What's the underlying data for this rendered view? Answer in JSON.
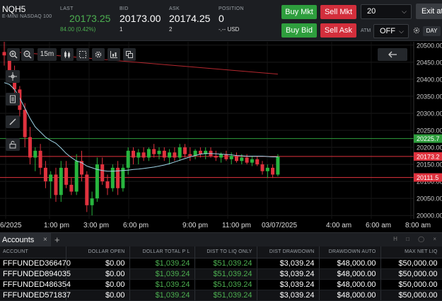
{
  "symbol": {
    "code": "NQH5",
    "description": "E-MINI NASDAQ 100"
  },
  "quote": {
    "last_label": "LAST",
    "last_value": "20173.25",
    "last_change": "84.00 (0.42%)",
    "bid_label": "BID",
    "bid_value": "20173.00",
    "bid_size": "1",
    "ask_label": "ASK",
    "ask_value": "20174.25",
    "ask_size": "2",
    "position_label": "POSITION",
    "position_value": "0",
    "position_sub": "-.-- USD"
  },
  "trade_buttons": {
    "buy_mkt": "Buy Mkt",
    "sell_mkt": "Sell Mkt",
    "buy_bid": "Buy Bid",
    "sell_ask": "Sell Ask",
    "exit": "Exit at"
  },
  "quantity": {
    "value": "20"
  },
  "atm": {
    "label": "ATM",
    "value": "OFF"
  },
  "day_button": "DAY",
  "colors": {
    "up": "#27b53e",
    "down": "#e0323e",
    "ma": "#9fd3e6",
    "green_level": "#2e9e3d",
    "red_level": "#e0323e"
  },
  "chart_data": {
    "type": "candlestick",
    "timeframe": "15m",
    "ylim": [
      19990,
      20510
    ],
    "y_ticks": [
      20000,
      20050,
      20100,
      20150,
      20200,
      20250,
      20300,
      20350,
      20400,
      20450,
      20500
    ],
    "y_tick_labels": [
      "20000.00",
      "20050.00",
      "20100.00",
      "20150.00",
      "20200.00",
      "20250.00",
      "20300.00",
      "20350.00",
      "20400.00",
      "20450.00",
      "20500.00"
    ],
    "x_tick_labels": [
      "6/2025",
      "1:00 pm",
      "3:00 pm",
      "6:00 pm",
      "9:00 pm",
      "11:00 pm",
      "03/07/2025",
      "4:00 am",
      "6:00 am",
      "8:00 am"
    ],
    "candles": [
      {
        "o": 20480,
        "h": 20510,
        "l": 20440,
        "c": 20470
      },
      {
        "o": 20470,
        "h": 20490,
        "l": 20400,
        "c": 20420
      },
      {
        "o": 20420,
        "h": 20440,
        "l": 20350,
        "c": 20370
      },
      {
        "o": 20370,
        "h": 20380,
        "l": 20290,
        "c": 20310
      },
      {
        "o": 20310,
        "h": 20330,
        "l": 20200,
        "c": 20230
      },
      {
        "o": 20230,
        "h": 20260,
        "l": 20150,
        "c": 20170
      },
      {
        "o": 20170,
        "h": 20200,
        "l": 20130,
        "c": 20190
      },
      {
        "o": 20190,
        "h": 20210,
        "l": 20120,
        "c": 20140
      },
      {
        "o": 20140,
        "h": 20160,
        "l": 20080,
        "c": 20100
      },
      {
        "o": 20100,
        "h": 20130,
        "l": 20050,
        "c": 20120
      },
      {
        "o": 20120,
        "h": 20140,
        "l": 20040,
        "c": 20060
      },
      {
        "o": 20060,
        "h": 20160,
        "l": 20040,
        "c": 20140
      },
      {
        "o": 20140,
        "h": 20160,
        "l": 20080,
        "c": 20090
      },
      {
        "o": 20090,
        "h": 20110,
        "l": 20060,
        "c": 20070
      },
      {
        "o": 20070,
        "h": 20180,
        "l": 20060,
        "c": 20160
      },
      {
        "o": 20160,
        "h": 20190,
        "l": 20100,
        "c": 20120
      },
      {
        "o": 20120,
        "h": 20130,
        "l": 20010,
        "c": 20030
      },
      {
        "o": 20030,
        "h": 20070,
        "l": 20000,
        "c": 20050
      },
      {
        "o": 20050,
        "h": 20170,
        "l": 20040,
        "c": 20150
      },
      {
        "o": 20150,
        "h": 20170,
        "l": 20090,
        "c": 20100
      },
      {
        "o": 20100,
        "h": 20120,
        "l": 20060,
        "c": 20080
      },
      {
        "o": 20080,
        "h": 20150,
        "l": 20070,
        "c": 20140
      },
      {
        "o": 20140,
        "h": 20160,
        "l": 20060,
        "c": 20080
      },
      {
        "o": 20080,
        "h": 20150,
        "l": 20070,
        "c": 20140
      },
      {
        "o": 20140,
        "h": 20200,
        "l": 20120,
        "c": 20190
      },
      {
        "o": 20190,
        "h": 20200,
        "l": 20150,
        "c": 20170
      },
      {
        "o": 20170,
        "h": 20195,
        "l": 20150,
        "c": 20185
      },
      {
        "o": 20185,
        "h": 20200,
        "l": 20160,
        "c": 20170
      },
      {
        "o": 20170,
        "h": 20200,
        "l": 20160,
        "c": 20195
      },
      {
        "o": 20195,
        "h": 20210,
        "l": 20170,
        "c": 20180
      },
      {
        "o": 20180,
        "h": 20200,
        "l": 20165,
        "c": 20190
      },
      {
        "o": 20190,
        "h": 20200,
        "l": 20160,
        "c": 20170
      },
      {
        "o": 20170,
        "h": 20195,
        "l": 20150,
        "c": 20185
      },
      {
        "o": 20185,
        "h": 20200,
        "l": 20160,
        "c": 20170
      },
      {
        "o": 20170,
        "h": 20210,
        "l": 20160,
        "c": 20200
      },
      {
        "o": 20200,
        "h": 20210,
        "l": 20170,
        "c": 20180
      },
      {
        "o": 20180,
        "h": 20200,
        "l": 20160,
        "c": 20175
      },
      {
        "o": 20175,
        "h": 20195,
        "l": 20165,
        "c": 20190
      },
      {
        "o": 20190,
        "h": 20200,
        "l": 20170,
        "c": 20180
      },
      {
        "o": 20180,
        "h": 20200,
        "l": 20165,
        "c": 20190
      },
      {
        "o": 20190,
        "h": 20200,
        "l": 20170,
        "c": 20175
      },
      {
        "o": 20175,
        "h": 20190,
        "l": 20160,
        "c": 20170
      },
      {
        "o": 20170,
        "h": 20185,
        "l": 20155,
        "c": 20180
      },
      {
        "o": 20180,
        "h": 20190,
        "l": 20160,
        "c": 20165
      },
      {
        "o": 20165,
        "h": 20185,
        "l": 20150,
        "c": 20175
      },
      {
        "o": 20175,
        "h": 20185,
        "l": 20155,
        "c": 20160
      },
      {
        "o": 20160,
        "h": 20180,
        "l": 20150,
        "c": 20170
      },
      {
        "o": 20170,
        "h": 20180,
        "l": 20150,
        "c": 20155
      },
      {
        "o": 20155,
        "h": 20175,
        "l": 20145,
        "c": 20165
      },
      {
        "o": 20165,
        "h": 20175,
        "l": 20145,
        "c": 20150
      },
      {
        "o": 20150,
        "h": 20160,
        "l": 20120,
        "c": 20130
      },
      {
        "o": 20130,
        "h": 20150,
        "l": 20110,
        "c": 20140
      },
      {
        "o": 20140,
        "h": 20150,
        "l": 20110,
        "c": 20120
      },
      {
        "o": 20120,
        "h": 20180,
        "l": 20115,
        "c": 20173
      }
    ],
    "moving_average": [
      20390,
      20385,
      20370,
      20345,
      20315,
      20285,
      20260,
      20245,
      20230,
      20220,
      20212,
      20198,
      20182,
      20170,
      20160,
      20155,
      20145,
      20140,
      20135,
      20132,
      20130,
      20130,
      20131,
      20132,
      20133,
      20135,
      20136,
      20138,
      20140,
      20142,
      20145,
      20148,
      20152,
      20157,
      20162,
      20167,
      20172,
      20176,
      20180,
      20182,
      20182,
      20181,
      20180,
      20179,
      20178,
      20176,
      20175,
      20174,
      20174,
      20174,
      20174,
      20173,
      20172,
      20172
    ],
    "trend_line": {
      "from": [
        2,
        20480
      ],
      "to": [
        53,
        20415
      ]
    },
    "levels": [
      {
        "value": 20225.75,
        "label": "20225.7",
        "color": "#2e9e3d"
      },
      {
        "value": 20173.25,
        "label": "20173.2",
        "color": "#e0323e"
      },
      {
        "value": 20111.5,
        "label": "20111.5",
        "color": "#e0323e"
      }
    ],
    "timeframe_label": "15m"
  },
  "accounts_panel": {
    "tab_label": "Accounts",
    "columns": [
      "ACCOUNT",
      "DOLLAR OPEN",
      "DOLLAR TOTAL P L",
      "DIST TO LIQ ONLY",
      "DIST DRAWDOWN",
      "DRAWDOWN AUTO",
      "MAX NET LIQ"
    ],
    "rows": [
      [
        "FFFUNDED366470",
        "$0.00",
        "$1,039.24",
        "$51,039.24",
        "$3,039.24",
        "$48,000.00",
        "$50,000.00"
      ],
      [
        "FFFUNDED894035",
        "$0.00",
        "$1,039.24",
        "$51,039.24",
        "$3,039.24",
        "$48,000.00",
        "$50,000.00"
      ],
      [
        "FFFUNDED486354",
        "$0.00",
        "$1,039.24",
        "$51,039.24",
        "$3,039.24",
        "$48,000.00",
        "$50,000.00"
      ],
      [
        "FFFUNDED571837",
        "$0.00",
        "$1,039.24",
        "$51,039.24",
        "$3,039.24",
        "$48,000.00",
        "$50,000.00"
      ]
    ]
  }
}
